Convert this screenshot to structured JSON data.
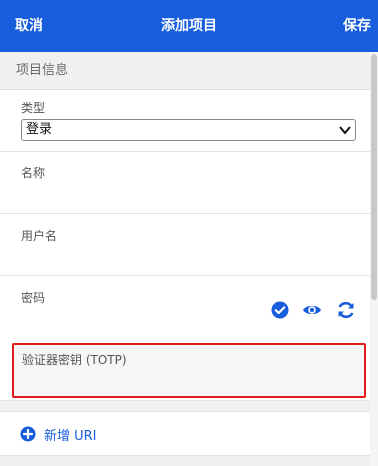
{
  "header": {
    "cancel_label": "取消",
    "title": "添加项目",
    "save_label": "保存",
    "background": "#175ddc"
  },
  "section": {
    "title": "项目信息"
  },
  "fields": {
    "type": {
      "label": "类型",
      "value": "登录"
    },
    "name": {
      "label": "名称",
      "value": ""
    },
    "username": {
      "label": "用户名",
      "value": ""
    },
    "password": {
      "label": "密码",
      "value": "",
      "icons": [
        "check-circle-icon",
        "eye-icon",
        "refresh-icon"
      ]
    },
    "totp": {
      "label": "验证器密钥 (TOTP)",
      "value": "",
      "highlight_color": "#e21b1b"
    }
  },
  "uri": {
    "add_label": "新增 URI",
    "icon": "plus-circle-icon"
  },
  "accent_color": "#175ddc"
}
